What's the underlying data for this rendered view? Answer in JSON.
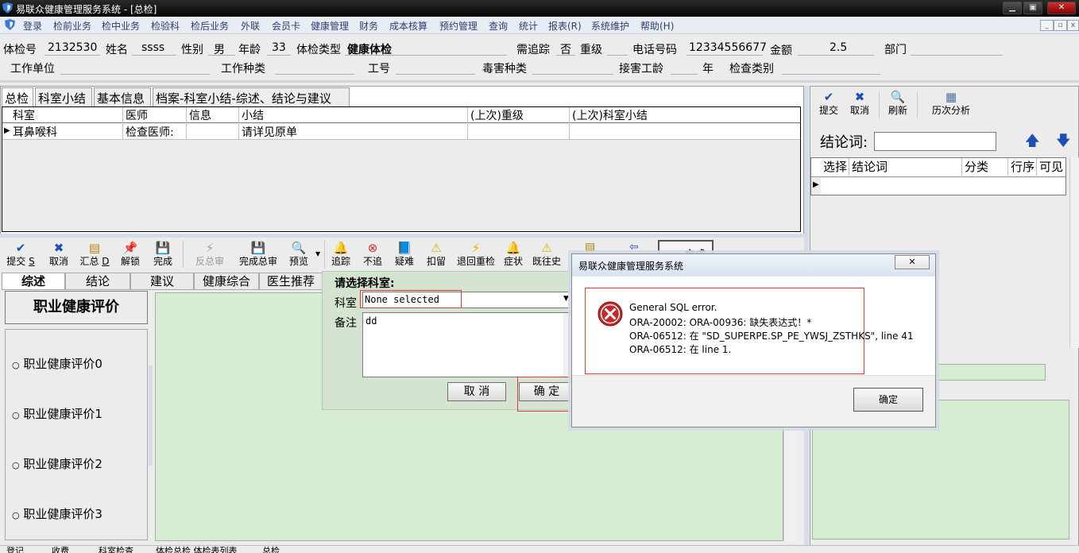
{
  "window": {
    "title": "易联众健康管理服务系统 - [总检]"
  },
  "menu": [
    "登录",
    "检前业务",
    "检中业务",
    "检验科",
    "检后业务",
    "外联",
    "会员卡",
    "健康管理",
    "财务",
    "成本核算",
    "预约管理",
    "查询",
    "统计",
    "报表(R)",
    "系统维护",
    "帮助(H)"
  ],
  "patient": {
    "exam_no_label": "体检号",
    "exam_no": "2132530",
    "name_label": "姓名",
    "name": "ssss",
    "gender_label": "性别",
    "gender": "男",
    "age_label": "年龄",
    "age": "33",
    "exam_type_label": "体检类型",
    "exam_type": "健康体检",
    "followup_label": "需追踪",
    "followup": "否",
    "severity_label": "重级",
    "phone_label": "电话号码",
    "phone": "12334556677",
    "amount_label": "金额",
    "amount": "2.5",
    "dept_label": "部门",
    "work_unit_label": "工作单位",
    "work_type_label": "工作种类",
    "work_no_label": "工号",
    "hazard_label": "毒害种类",
    "exposure_label": "接害工龄",
    "year_label": "年",
    "exam_category_label": "检查类别"
  },
  "top_tabs": [
    "总检",
    "科室小结",
    "基本信息",
    "档案-科室小结-综述、结论与建议"
  ],
  "summary_grid": {
    "columns": [
      "科室",
      "医师",
      "信息",
      "小结",
      "(上次)重级",
      "(上次)科室小结"
    ],
    "rows": [
      [
        "耳鼻喉科",
        "检查医师:",
        "",
        "请详见原单",
        "",
        ""
      ]
    ]
  },
  "right_toolbar": [
    {
      "icon": "checkmark-icon",
      "label": "提交"
    },
    {
      "icon": "cross-icon",
      "label": "取消"
    },
    {
      "icon": "refresh-icon",
      "label": "刷新"
    },
    {
      "icon": "history-icon",
      "label": "历次分析"
    }
  ],
  "conclusion": {
    "label": "结论词:",
    "value": "",
    "columns": [
      "选择",
      "结论词",
      "分类",
      "行序",
      "可见"
    ]
  },
  "main_toolbar": [
    {
      "icon": "checkmark-icon",
      "label": "提交",
      "shortcut": "S"
    },
    {
      "icon": "cross-icon",
      "label": "取消"
    },
    {
      "icon": "calculator-icon",
      "label": "汇总",
      "shortcut": "D"
    },
    {
      "icon": "pin-icon",
      "label": "解锁"
    },
    {
      "icon": "save-icon",
      "label": "完成"
    },
    {
      "icon": "lightning-icon",
      "label": "反总审",
      "disabled": true
    },
    {
      "icon": "save-icon",
      "label": "完成总审"
    },
    {
      "icon": "preview-icon",
      "label": "预览"
    },
    {
      "icon": "bell-icon",
      "label": "追踪"
    },
    {
      "icon": "no-icon",
      "label": "不追"
    },
    {
      "icon": "book-icon",
      "label": "疑难"
    },
    {
      "icon": "warning-icon",
      "label": "扣留"
    },
    {
      "icon": "lightning-icon",
      "label": "退回重检"
    },
    {
      "icon": "bell-icon",
      "label": "症状"
    },
    {
      "icon": "warning-icon",
      "label": "既往史"
    }
  ],
  "done_button": "完成",
  "sub_tabs": [
    "综述",
    "结论",
    "建议",
    "健康综合",
    "医生推荐"
  ],
  "eval_title": "职业健康评价",
  "eval_options": [
    "职业健康评价0",
    "职业健康评价1",
    "职业健康评价2",
    "职业健康评价3"
  ],
  "dept_popup": {
    "title": "请选择科室:",
    "dept_label": "科室",
    "dept_value": "None selected",
    "note_label": "备注",
    "note_value": "dd",
    "cancel": "取 消",
    "ok": "确 定"
  },
  "error_dialog": {
    "title": "易联众健康管理服务系统",
    "lines": [
      "General SQL error.",
      "ORA-20002: ORA-00936: 缺失表达式！*",
      "ORA-06512: 在 \"SD_SUPERPE.SP_PE_YWSJ_ZSTHKS\", line 41",
      "ORA-06512: 在 line 1."
    ],
    "ok": "确定"
  },
  "status_bar": [
    "登记",
    "收费",
    "科室检查",
    "体检总检  体检表列表",
    "总检"
  ],
  "colors": {
    "menu_text": "#2d3f72",
    "green_panel": "#d6ecd3",
    "error_red": "#c62828",
    "highlight_red": "#e53935"
  }
}
